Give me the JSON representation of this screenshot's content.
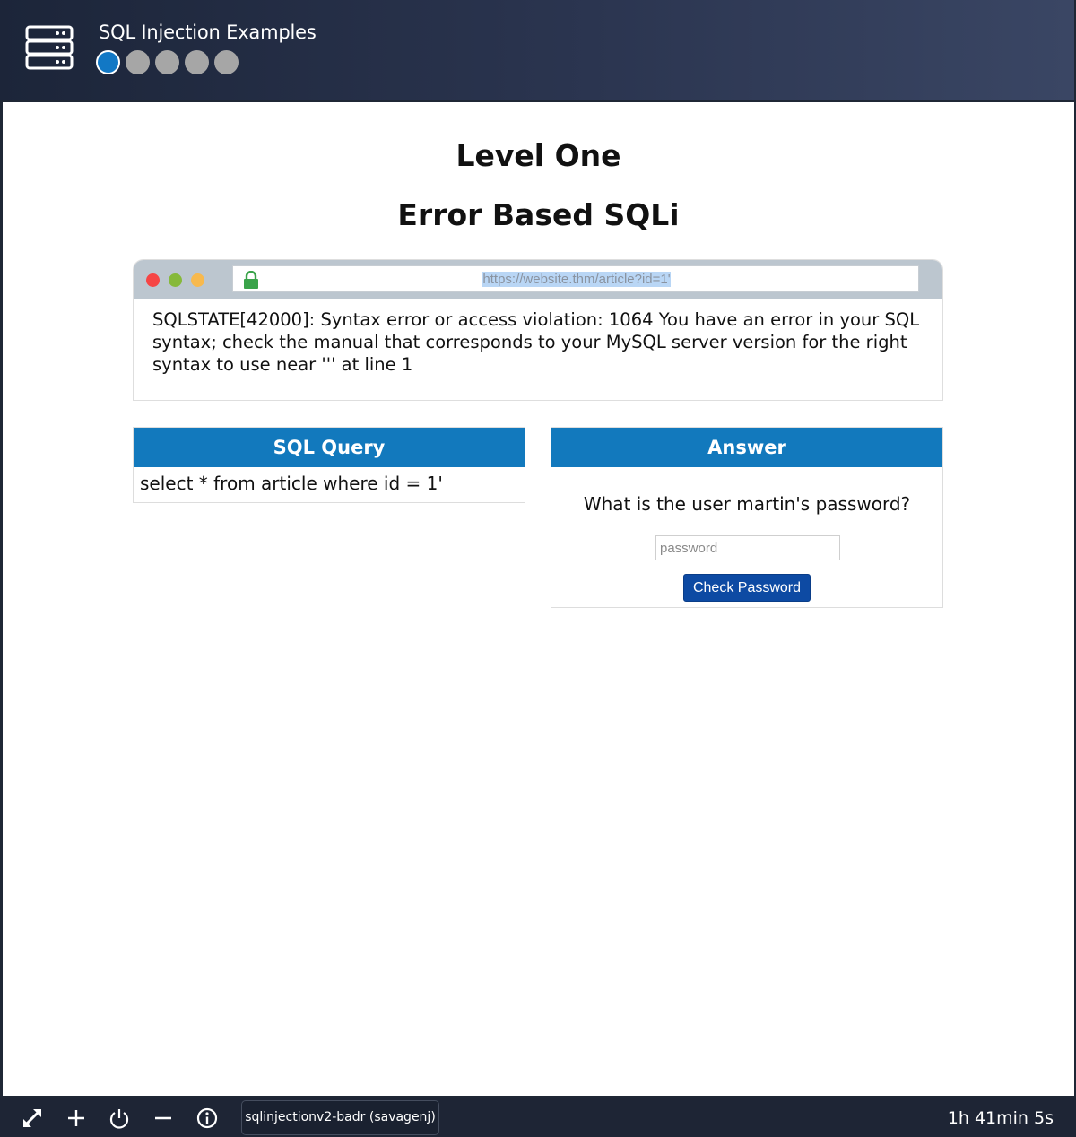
{
  "header": {
    "title": "SQL Injection Examples",
    "steps": 5,
    "active_step": 1,
    "accent": "#1278c5"
  },
  "main": {
    "heading": "Level One",
    "subheading": "Error Based SQLi"
  },
  "browser": {
    "url": "https://website.thm/article?id=1'",
    "error_message": "SQLSTATE[42000]: Syntax error or access violation: 1064 You have an error in your SQL syntax; check the manual that corresponds to your MySQL server version for the right syntax to use near ''' at line 1"
  },
  "sql_panel": {
    "title": "SQL Query",
    "query": "select * from article where id = 1'"
  },
  "answer_panel": {
    "title": "Answer",
    "question": "What is the user martin's password?",
    "input_placeholder": "password",
    "input_value": "",
    "button_label": "Check Password"
  },
  "toolbar": {
    "icons": [
      "expand-icon",
      "plus-icon",
      "power-icon",
      "minus-icon",
      "info-icon"
    ],
    "machine_label": "sqlinjectionv2-badr (savagenj)",
    "timer": "1h 41min 5s"
  },
  "colors": {
    "panel_header": "#1279bd",
    "button": "#0d4aa3",
    "lock": "#3aa34a"
  }
}
